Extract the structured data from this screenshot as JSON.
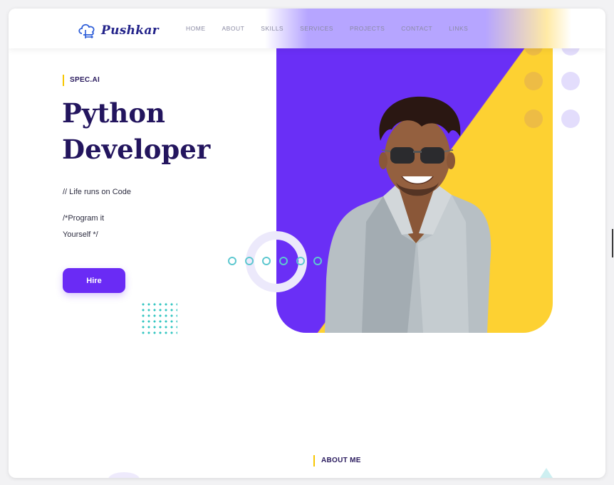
{
  "brand": {
    "name": "Pushkar",
    "icon": "cloud-logo-icon"
  },
  "nav": {
    "items": [
      {
        "label": "HOME"
      },
      {
        "label": "ABOUT"
      },
      {
        "label": "SKILLS"
      },
      {
        "label": "SERVICES"
      },
      {
        "label": "PROJECTS"
      },
      {
        "label": "CONTACT"
      },
      {
        "label": "LINKS"
      }
    ]
  },
  "hero": {
    "tag": "SPEC.AI",
    "title_line1": "Python",
    "title_line2": "Developer",
    "comment1": "// Life runs on Code",
    "comment2_line1": "/*Program it",
    "comment2_line2": "Yourself */",
    "cta": "Hire"
  },
  "about": {
    "tag": "ABOUT ME"
  },
  "colors": {
    "accent": "#6a2bf5",
    "yellow": "#fdd132",
    "headline": "#23155e",
    "teal": "#33c6c1"
  }
}
